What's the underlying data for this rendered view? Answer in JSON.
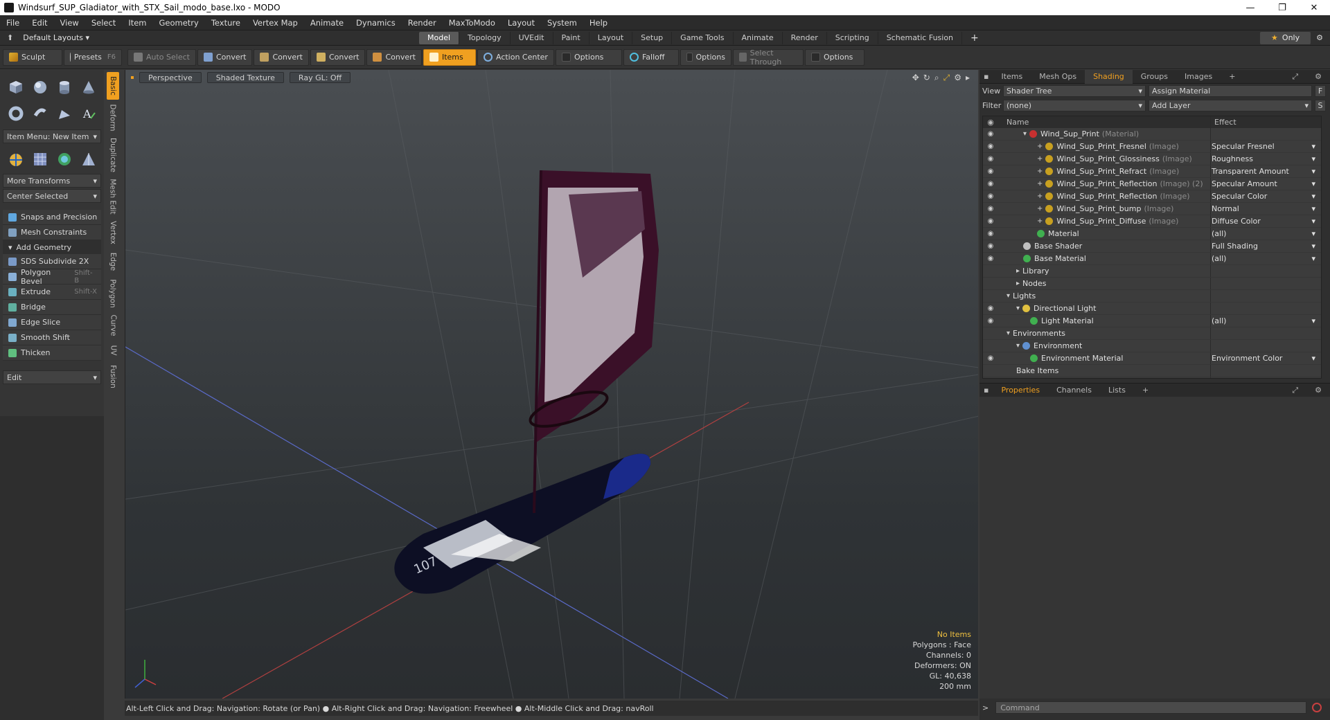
{
  "window": {
    "title": "Windsurf_SUP_Gladiator_with_STX_Sail_modo_base.lxo - MODO",
    "minimize": "—",
    "maximize": "❐",
    "close": "✕"
  },
  "menu": [
    "File",
    "Edit",
    "View",
    "Select",
    "Item",
    "Geometry",
    "Texture",
    "Vertex Map",
    "Animate",
    "Dynamics",
    "Render",
    "MaxToModo",
    "Layout",
    "System",
    "Help"
  ],
  "layoutbar": {
    "layout": "Default Layouts ▾",
    "tabs": [
      "Model",
      "Topology",
      "UVEdit",
      "Paint",
      "Layout",
      "Setup",
      "Game Tools",
      "Animate",
      "Render",
      "Scripting",
      "Schematic Fusion"
    ],
    "active_tab": "Model",
    "plus": "+",
    "only": "Only",
    "star": "★"
  },
  "toolbar": {
    "sculpt": "Sculpt",
    "presets": "Presets",
    "presets_key": "F6",
    "auto_select": "Auto Select",
    "convert": "Convert",
    "items": "Items",
    "action_center": "Action Center",
    "options": "Options",
    "falloff": "Falloff",
    "select_through": "Select Through"
  },
  "leftpanel": {
    "item_menu": "Item Menu: New Item",
    "more_transforms": "More Transforms",
    "center_selected": "Center Selected",
    "snaps": "Snaps and Precision",
    "constraints": "Mesh Constraints",
    "add_geometry": "Add Geometry",
    "tools": [
      {
        "label": "SDS Subdivide 2X",
        "key": ""
      },
      {
        "label": "Polygon Bevel",
        "key": "Shift-B"
      },
      {
        "label": "Extrude",
        "key": "Shift-X"
      },
      {
        "label": "Bridge",
        "key": ""
      },
      {
        "label": "Edge Slice",
        "key": ""
      },
      {
        "label": "Smooth Shift",
        "key": ""
      },
      {
        "label": "Thicken",
        "key": ""
      }
    ],
    "edit": "Edit",
    "sidetabs": [
      "Basic",
      "Deform",
      "Duplicate",
      "Mesh Edit",
      "Vertex",
      "Edge",
      "Polygon",
      "Curve",
      "UV",
      "Fusion"
    ]
  },
  "viewport": {
    "perspective": "Perspective",
    "shading": "Shaded Texture",
    "raygl": "Ray GL: Off",
    "info": {
      "items": "No Items",
      "polygons": "Polygons : Face",
      "channels": "Channels: 0",
      "deformers": "Deformers: ON",
      "gl": "GL: 40,638",
      "unit": "200 mm"
    },
    "board_text": "107"
  },
  "status": "Alt-Left Click and Drag: Navigation: Rotate (or Pan) ● Alt-Right Click and Drag: Navigation: Freewheel ● Alt-Middle Click and Drag: navRoll",
  "rightpanel": {
    "tabs": [
      "Items",
      "Mesh Ops",
      "Shading",
      "Groups",
      "Images",
      "+"
    ],
    "active_tab": "Shading",
    "view_label": "View",
    "view_value": "Shader Tree",
    "assign": "Assign Material",
    "filter_label": "Filter",
    "filter_value": "(none)",
    "add_layer": "Add Layer",
    "f_btn": "F",
    "s_btn": "S",
    "col_name": "Name",
    "col_effect": "Effect",
    "rows": [
      {
        "indent": 58,
        "name": "Wind_Sup_Print",
        "type": "(Material)",
        "effect": "",
        "eye": true,
        "ball": "#c83030",
        "pm": "▾"
      },
      {
        "indent": 78,
        "name": "Wind_Sup_Print_Fresnel",
        "type": "(Image)",
        "effect": "Specular Fresnel",
        "eye": true,
        "ball": "#c8a020",
        "pm": "+"
      },
      {
        "indent": 78,
        "name": "Wind_Sup_Print_Glossiness",
        "type": "(Image)",
        "effect": "Roughness",
        "eye": true,
        "ball": "#c8a020",
        "pm": "+"
      },
      {
        "indent": 78,
        "name": "Wind_Sup_Print_Refract",
        "type": "(Image)",
        "effect": "Transparent Amount",
        "eye": true,
        "ball": "#c8a020",
        "pm": "+"
      },
      {
        "indent": 78,
        "name": "Wind_Sup_Print_Reflection",
        "type": "(Image) (2)",
        "effect": "Specular Amount",
        "eye": true,
        "ball": "#c8a020",
        "pm": "+"
      },
      {
        "indent": 78,
        "name": "Wind_Sup_Print_Reflection",
        "type": "(Image)",
        "effect": "Specular Color",
        "eye": true,
        "ball": "#c8a020",
        "pm": "+"
      },
      {
        "indent": 78,
        "name": "Wind_Sup_Print_bump",
        "type": "(Image)",
        "effect": "Normal",
        "eye": true,
        "ball": "#c8a020",
        "pm": "+"
      },
      {
        "indent": 78,
        "name": "Wind_Sup_Print_Diffuse",
        "type": "(Image)",
        "effect": "Diffuse Color",
        "eye": true,
        "ball": "#c8a020",
        "pm": "+"
      },
      {
        "indent": 78,
        "name": "Material",
        "type": "",
        "effect": "(all)",
        "eye": true,
        "ball": "#40b050",
        "pm": ""
      },
      {
        "indent": 58,
        "name": "Base Shader",
        "type": "",
        "effect": "Full Shading",
        "eye": true,
        "ball": "#c0c0c0",
        "pm": ""
      },
      {
        "indent": 58,
        "name": "Base Material",
        "type": "",
        "effect": "(all)",
        "eye": true,
        "ball": "#40b050",
        "pm": ""
      },
      {
        "indent": 48,
        "name": "Library",
        "type": "",
        "effect": "",
        "eye": false,
        "ball": "",
        "pm": "▸"
      },
      {
        "indent": 48,
        "name": "Nodes",
        "type": "",
        "effect": "",
        "eye": false,
        "ball": "",
        "pm": "▸"
      },
      {
        "indent": 34,
        "name": "Lights",
        "type": "",
        "effect": "",
        "eye": false,
        "ball": "",
        "pm": "▾"
      },
      {
        "indent": 48,
        "name": "Directional Light",
        "type": "",
        "effect": "",
        "eye": true,
        "ball": "#e0c040",
        "pm": "▾"
      },
      {
        "indent": 68,
        "name": "Light Material",
        "type": "",
        "effect": "(all)",
        "eye": true,
        "ball": "#40b050",
        "pm": ""
      },
      {
        "indent": 34,
        "name": "Environments",
        "type": "",
        "effect": "",
        "eye": false,
        "ball": "",
        "pm": "▾"
      },
      {
        "indent": 48,
        "name": "Environment",
        "type": "",
        "effect": "",
        "eye": false,
        "ball": "#6090d0",
        "pm": "▾"
      },
      {
        "indent": 68,
        "name": "Environment Material",
        "type": "",
        "effect": "Environment Color",
        "eye": true,
        "ball": "#40b050",
        "pm": ""
      },
      {
        "indent": 48,
        "name": "Bake Items",
        "type": "",
        "effect": "",
        "eye": false,
        "ball": "",
        "pm": ""
      }
    ],
    "props_tabs": [
      "Properties",
      "Channels",
      "Lists",
      "+"
    ],
    "props_active": "Properties",
    "command_placeholder": "Command"
  }
}
